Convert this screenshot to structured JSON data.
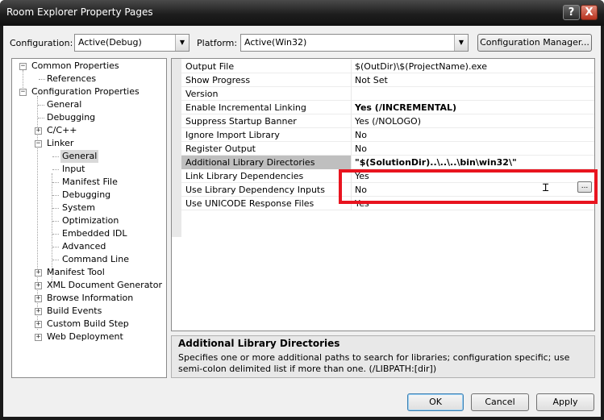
{
  "window": {
    "title": "Room Explorer Property Pages"
  },
  "titlebar": {
    "help_label": "?",
    "close_label": "X"
  },
  "config": {
    "configuration_label": "Configuration:",
    "configuration_value": "Active(Debug)",
    "platform_label": "Platform:",
    "platform_value": "Active(Win32)",
    "manager_button": "Configuration Manager..."
  },
  "tree": {
    "common_properties": "Common Properties",
    "references": "References",
    "configuration_properties": "Configuration Properties",
    "general": "General",
    "debugging": "Debugging",
    "cpp": "C/C++",
    "linker": "Linker",
    "linker_children": [
      "General",
      "Input",
      "Manifest File",
      "Debugging",
      "System",
      "Optimization",
      "Embedded IDL",
      "Advanced",
      "Command Line"
    ],
    "manifest_tool": "Manifest Tool",
    "xml_doc_generator": "XML Document Generator",
    "browse_information": "Browse Information",
    "build_events": "Build Events",
    "custom_build_step": "Custom Build Step",
    "web_deployment": "Web Deployment"
  },
  "properties": [
    {
      "name": "Output File",
      "value": "$(OutDir)\\$(ProjectName).exe"
    },
    {
      "name": "Show Progress",
      "value": "Not Set"
    },
    {
      "name": "Version",
      "value": ""
    },
    {
      "name": "Enable Incremental Linking",
      "value": "Yes (/INCREMENTAL)"
    },
    {
      "name": "Suppress Startup Banner",
      "value": "Yes (/NOLOGO)"
    },
    {
      "name": "Ignore Import Library",
      "value": "No"
    },
    {
      "name": "Register Output",
      "value": "No"
    },
    {
      "name": "Additional Library Directories",
      "value": "\"$(SolutionDir)..\\..\\..\\bin\\win32\\\""
    },
    {
      "name": "Link Library Dependencies",
      "value": "Yes"
    },
    {
      "name": "Use Library Dependency Inputs",
      "value": "No"
    },
    {
      "name": "Use UNICODE Response Files",
      "value": "Yes"
    }
  ],
  "editor": {
    "ellipsis_label": "..."
  },
  "description": {
    "title": "Additional Library Directories",
    "text": "Specifies one or more additional paths to search for libraries; configuration specific; use semi-colon delimited list if more than one.      (/LIBPATH:[dir])"
  },
  "buttons": {
    "ok": "OK",
    "cancel": "Cancel",
    "apply": "Apply"
  },
  "colors": {
    "highlight_border": "#e8141f",
    "selected_row": "#bfbfbf"
  }
}
